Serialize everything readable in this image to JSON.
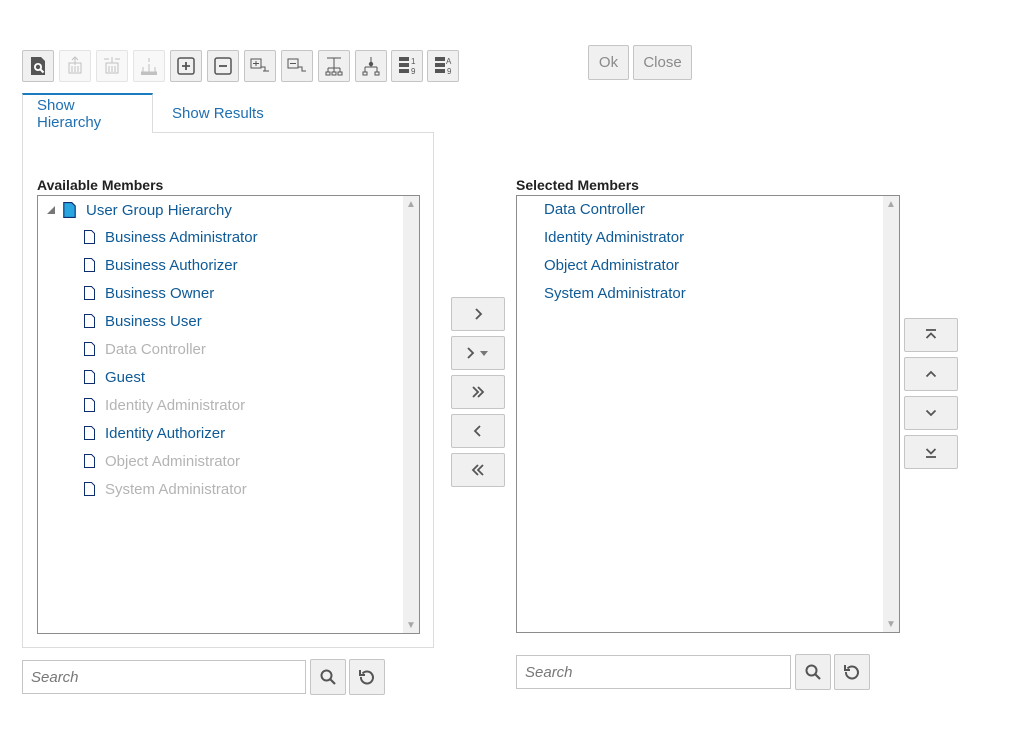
{
  "toolbar": {
    "buttons": [
      {
        "icon": "search-document-icon",
        "enabled": true
      },
      {
        "icon": "move-up-level-icon",
        "enabled": false
      },
      {
        "icon": "move-down-level-icon",
        "enabled": false
      },
      {
        "icon": "select-children-icon",
        "enabled": false
      },
      {
        "icon": "expand-plus-icon",
        "enabled": true
      },
      {
        "icon": "collapse-minus-icon",
        "enabled": true
      },
      {
        "icon": "expand-all-icon",
        "enabled": true
      },
      {
        "icon": "collapse-all-icon",
        "enabled": true
      },
      {
        "icon": "hierarchy-view-icon",
        "enabled": true
      },
      {
        "icon": "hierarchy-tree-icon",
        "enabled": true
      },
      {
        "icon": "sort-numeric-icon",
        "enabled": true
      },
      {
        "icon": "sort-alpha-icon",
        "enabled": true
      }
    ]
  },
  "dialog": {
    "ok_label": "Ok",
    "close_label": "Close"
  },
  "tabs": [
    {
      "label": "Show Hierarchy",
      "active": true
    },
    {
      "label": "Show Results",
      "active": false
    }
  ],
  "available": {
    "title": "Available Members",
    "root": "User Group Hierarchy",
    "items": [
      {
        "label": "Business Administrator",
        "selected": false
      },
      {
        "label": "Business Authorizer",
        "selected": false
      },
      {
        "label": "Business Owner",
        "selected": false
      },
      {
        "label": "Business User",
        "selected": false
      },
      {
        "label": "Data Controller",
        "selected": true
      },
      {
        "label": "Guest",
        "selected": false
      },
      {
        "label": "Identity Administrator",
        "selected": true
      },
      {
        "label": "Identity Authorizer",
        "selected": false
      },
      {
        "label": "Object Administrator",
        "selected": true
      },
      {
        "label": "System Administrator",
        "selected": true
      }
    ],
    "search_placeholder": "Search"
  },
  "selected": {
    "title": "Selected Members",
    "items": [
      "Data Controller",
      "Identity Administrator",
      "Object Administrator",
      "System Administrator"
    ],
    "search_placeholder": "Search"
  },
  "shuttle": [
    "move-right-icon",
    "move-right-options-icon",
    "move-all-right-icon",
    "move-left-icon",
    "move-all-left-icon"
  ],
  "ordering": [
    "move-to-top-icon",
    "move-up-icon",
    "move-down-icon",
    "move-to-bottom-icon"
  ],
  "colors": {
    "link": "#0e5a96",
    "disabled_text": "#b4b4b4",
    "tab_accent": "#1a7bbf",
    "button_bg": "#f0f0f0"
  }
}
